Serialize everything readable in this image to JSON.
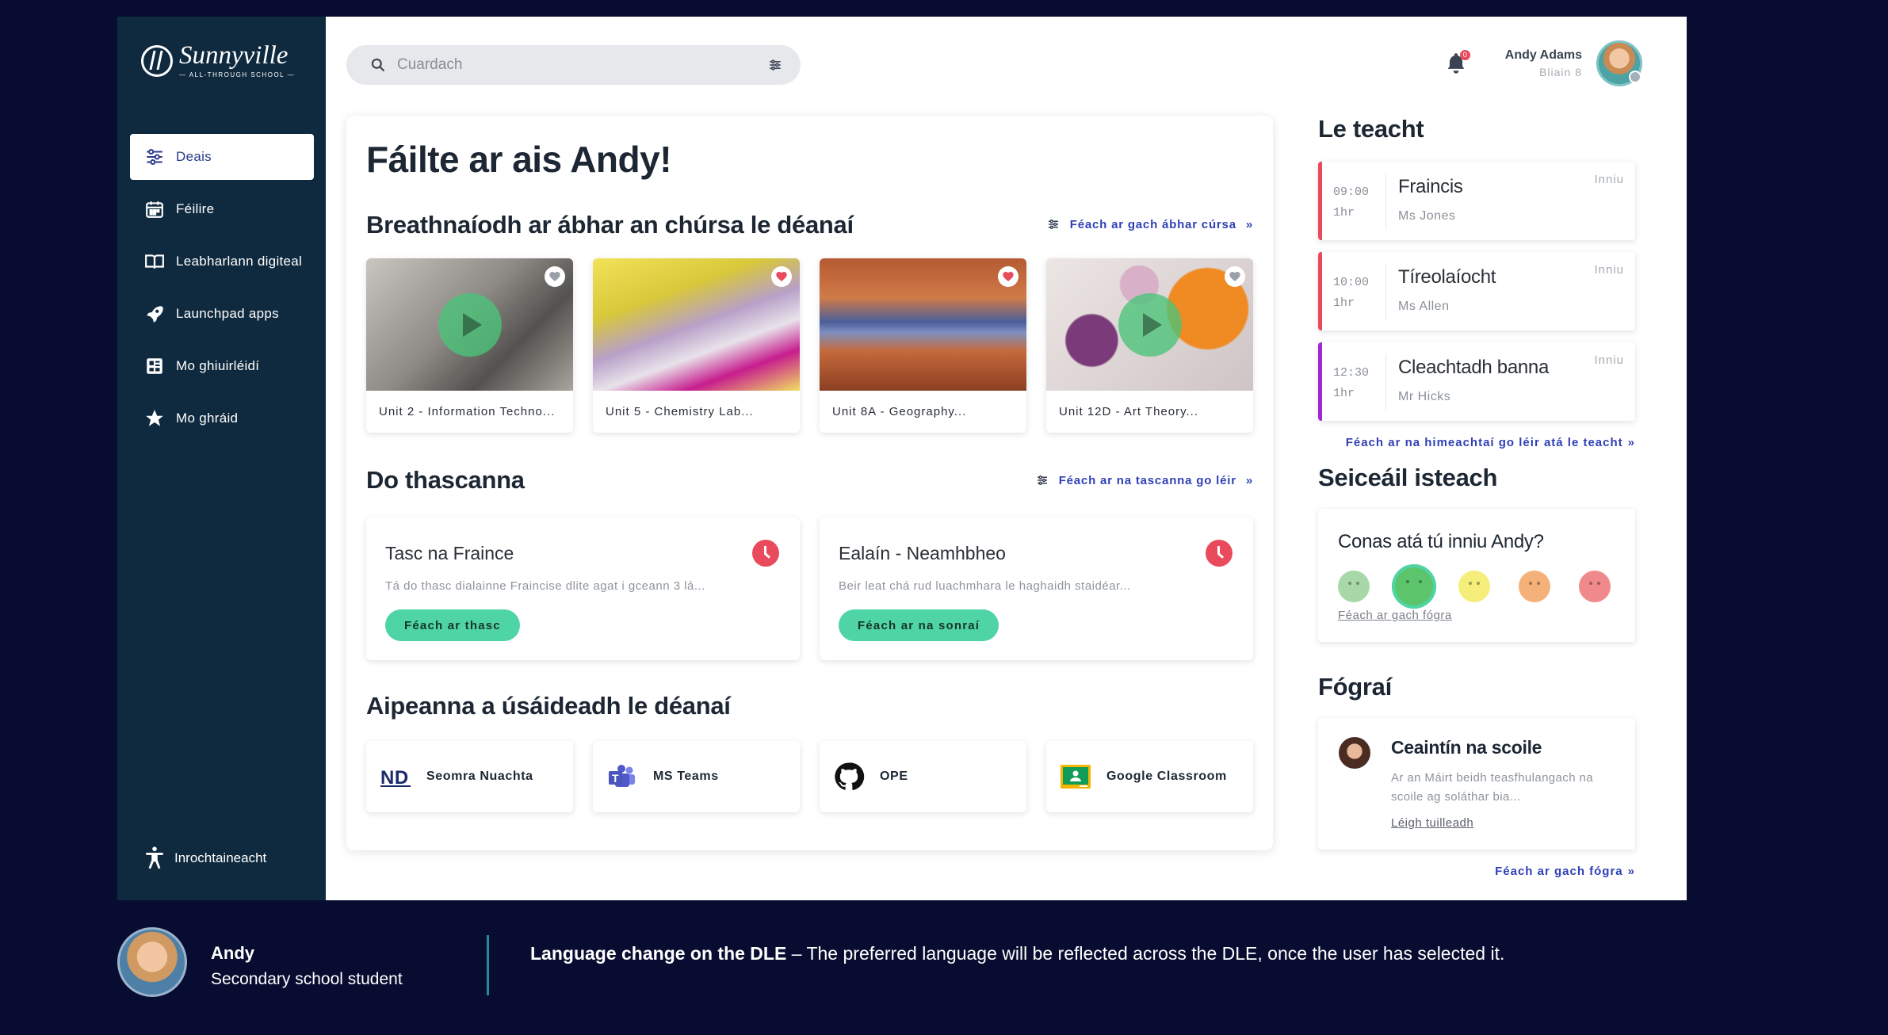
{
  "colors": {
    "page_bg": "#080c30",
    "sidebar_bg": "#0f2a3f",
    "accent_green": "#4fd4a6",
    "accent_red": "#e94a5c",
    "link_blue": "#2f3fb5",
    "purple": "#a326d6"
  },
  "logo": {
    "name": "Sunnyville",
    "sub": "— ALL-THROUGH SCHOOL —"
  },
  "sidebar": {
    "items": [
      {
        "label": "Deais",
        "icon": "sliders-icon",
        "active": true
      },
      {
        "label": "Féilire",
        "icon": "calendar-icon"
      },
      {
        "label": "Leabharlann digiteal",
        "icon": "book-icon"
      },
      {
        "label": "Launchpad apps",
        "icon": "rocket-icon"
      },
      {
        "label": "Mo ghiuirléidí",
        "icon": "widgets-icon"
      },
      {
        "label": "Mo ghráid",
        "icon": "star-icon"
      }
    ],
    "accessibility": "Inrochtaineacht"
  },
  "search": {
    "placeholder": "Cuardach"
  },
  "user": {
    "name": "Andy Adams",
    "class": "Bliain 8",
    "notifications": "0"
  },
  "main": {
    "welcome": "Fáilte ar ais Andy!",
    "recent_courses": {
      "title": "Breathnaíodh ar ábhar an chúrsa le déanaí",
      "see_all": "Féach ar gach ábhar cúrsa",
      "items": [
        {
          "label": "Unit 2 - Information Techno...",
          "fav": false,
          "video": true,
          "theme": "it"
        },
        {
          "label": "Unit 5 - Chemistry Lab...",
          "fav": true,
          "video": false,
          "theme": "chem"
        },
        {
          "label": "Unit 8A - Geography...",
          "fav": true,
          "video": false,
          "theme": "geo"
        },
        {
          "label": "Unit 12D - Art Theory...",
          "fav": false,
          "video": true,
          "theme": "art"
        }
      ]
    },
    "tasks": {
      "title": "Do thascanna",
      "see_all": "Féach ar na tascanna go léir",
      "items": [
        {
          "title": "Tasc na Fraince",
          "desc": "Tá do thasc dialainne Fraincise dlite agat i gceann 3 lá...",
          "button": "Féach ar thasc"
        },
        {
          "title": "Ealaín - Neamhbheo",
          "desc": "Beir leat chá rud luachmhara le haghaidh staidéar...",
          "button": "Féach ar na sonraí"
        }
      ]
    },
    "apps": {
      "title": "Aipeanna a úsáideadh le déanaí",
      "items": [
        {
          "label": "Seomra Nuachta",
          "icon": "newsroom-icon"
        },
        {
          "label": "MS Teams",
          "icon": "teams-icon"
        },
        {
          "label": "OPE",
          "icon": "github-icon"
        },
        {
          "label": "Google Classroom",
          "icon": "classroom-icon"
        }
      ]
    }
  },
  "right": {
    "upcoming": {
      "title": "Le teacht",
      "see_all": "Féach ar na himeachtaí go léir atá le teacht",
      "lessons": [
        {
          "time": "09:00",
          "duration": "1hr",
          "subject": "Fraincis",
          "teacher": "Ms Jones",
          "when": "Inniu",
          "color": "red"
        },
        {
          "time": "10:00",
          "duration": "1hr",
          "subject": "Tíreolaíocht",
          "teacher": "Ms Allen",
          "when": "Inniu",
          "color": "red"
        },
        {
          "time": "12:30",
          "duration": "1hr",
          "subject": "Cleachtadh banna",
          "teacher": "Mr Hicks",
          "when": "Inniu",
          "color": "purple"
        }
      ]
    },
    "checkin": {
      "title": "Seiceáil isteach",
      "question": "Conas atá tú inniu Andy?",
      "moods": [
        "#a8d8a8",
        "#5cc46a",
        "#f5ee7a",
        "#f4b27a",
        "#f08a8a"
      ],
      "selected_mood": 1,
      "link": "Féach ar gach fógra"
    },
    "notices": {
      "title": "Fógraí",
      "item": {
        "title": "Ceaintín na scoile",
        "body": "Ar an Máirt beidh teasfhulangach na scoile ag soláthar bia...",
        "link": "Léigh tuilleadh"
      },
      "see_all": "Féach ar gach fógra"
    }
  },
  "caption": {
    "name": "Andy",
    "role": "Secondary school student",
    "headline": "Language change on the DLE",
    "text": " – The preferred language will be reflected across the DLE, once the user has selected it."
  }
}
